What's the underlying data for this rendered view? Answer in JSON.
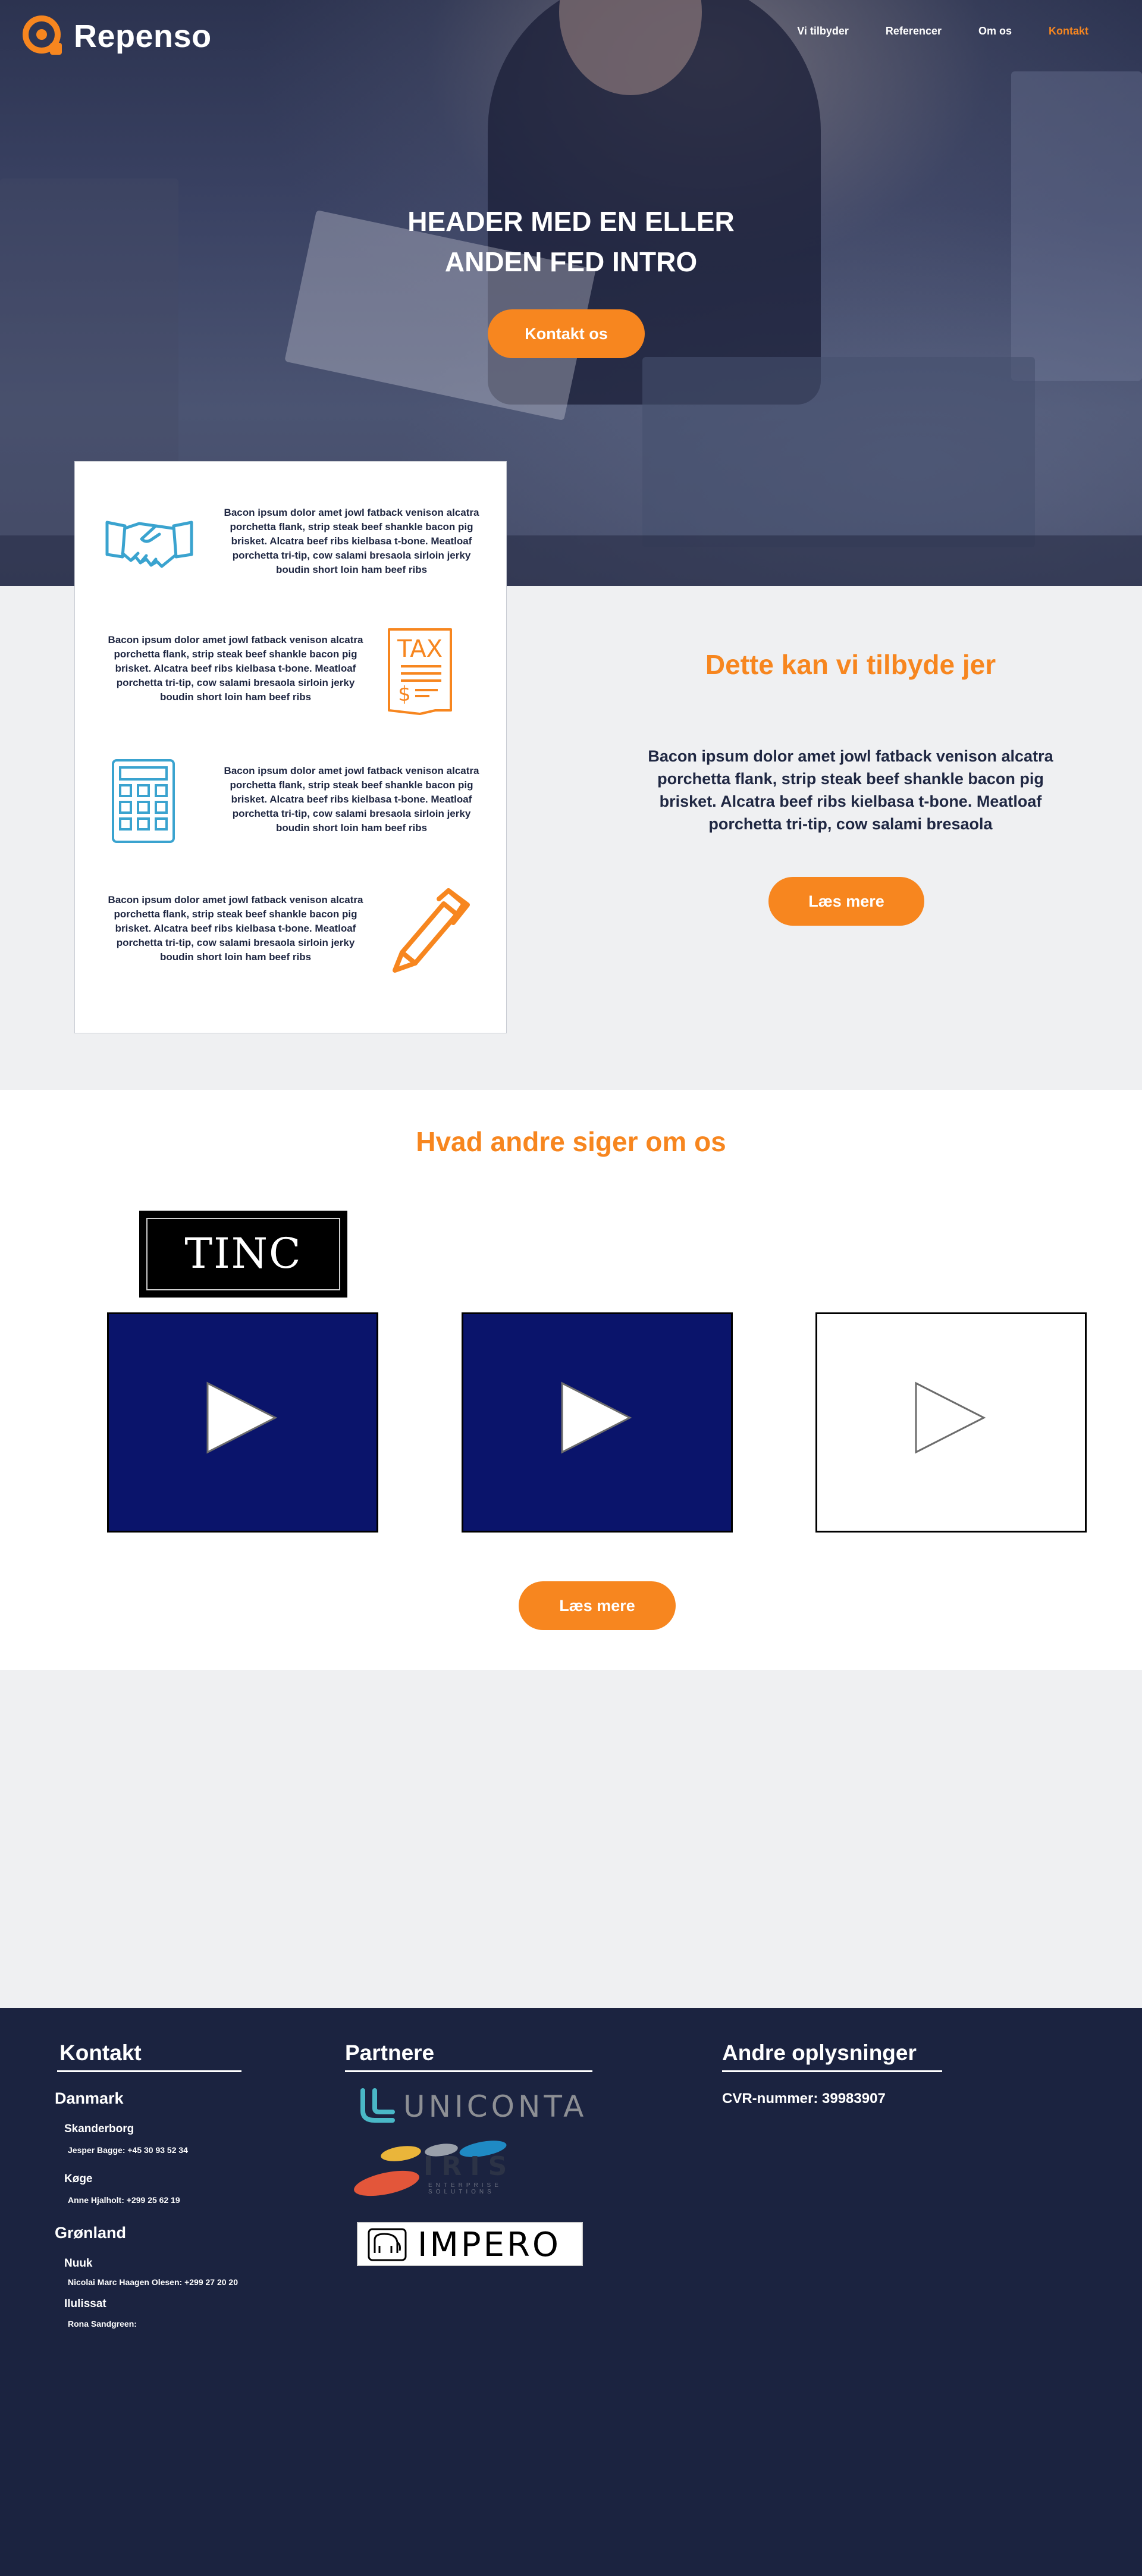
{
  "brand": {
    "name": "Repenso",
    "accent": "#f7861f",
    "navy": "#1b2340"
  },
  "nav": {
    "items": [
      {
        "label": "Vi tilbyder"
      },
      {
        "label": "Referencer"
      },
      {
        "label": "Om os"
      },
      {
        "label": "Kontakt"
      }
    ]
  },
  "hero": {
    "title_line1": "HEADER MED EN ELLER",
    "title_line2": "ANDEN FED INTRO",
    "cta_label": "Kontakt os"
  },
  "services": {
    "items": [
      {
        "icon": "handshake-icon",
        "text": "Bacon ipsum dolor amet jowl fatback venison alcatra porchetta flank, strip steak beef shankle bacon pig brisket. Alcatra beef ribs kielbasa t-bone. Meatloaf porchetta tri-tip, cow salami bresaola sirloin jerky boudin short loin ham beef ribs"
      },
      {
        "icon": "tax-document-icon",
        "text": "Bacon ipsum dolor amet jowl fatback venison alcatra porchetta flank, strip steak beef shankle bacon pig brisket. Alcatra beef ribs kielbasa t-bone. Meatloaf porchetta tri-tip, cow salami bresaola sirloin jerky boudin short loin ham beef ribs"
      },
      {
        "icon": "calculator-icon",
        "text": "Bacon ipsum dolor amet jowl fatback venison alcatra porchetta flank, strip steak beef shankle bacon pig brisket. Alcatra beef ribs kielbasa t-bone. Meatloaf porchetta tri-tip, cow salami bresaola sirloin jerky boudin short loin ham beef ribs"
      },
      {
        "icon": "pen-icon",
        "text": "Bacon ipsum dolor amet jowl fatback venison alcatra porchetta flank, strip steak beef shankle bacon pig brisket. Alcatra beef ribs kielbasa t-bone. Meatloaf porchetta tri-tip, cow salami bresaola sirloin jerky boudin short loin ham beef ribs"
      }
    ],
    "tax_label": "TAX",
    "offer_title": "Dette kan vi tilbyde jer",
    "offer_text": "Bacon ipsum dolor amet jowl fatback venison alcatra porchetta flank, strip steak beef shankle bacon pig brisket. Alcatra beef ribs kielbasa t-bone. Meatloaf porchetta tri-tip, cow salami bresaola",
    "offer_cta": "Læs mere"
  },
  "testimonials": {
    "title": "Hvad andre siger om os",
    "logo_text": "TINC",
    "cta_label": "Læs mere"
  },
  "footer": {
    "contact_heading": "Kontakt",
    "countries": [
      {
        "name": "Danmark",
        "cities": [
          {
            "name": "Skanderborg",
            "person": "Jesper Bagge: +45 30 93 52 34"
          },
          {
            "name": "Køge",
            "person": "Anne Hjalholt: +299 25 62 19"
          }
        ]
      },
      {
        "name": "Grønland",
        "cities": [
          {
            "name": "Nuuk",
            "person": "Nicolai Marc Haagen Olesen: +299 27 20 20"
          },
          {
            "name": "Ilulissat",
            "person": "Rona Sandgreen:"
          }
        ]
      }
    ],
    "partners_heading": "Partnere",
    "partners": [
      {
        "name": "UNICONTA"
      },
      {
        "name": "IRIS",
        "sub": "ENTERPRISE SOLUTIONS"
      },
      {
        "name": "IMPERO"
      }
    ],
    "other_heading": "Andre oplysninger",
    "cvr": "CVR-nummer: 39983907"
  }
}
